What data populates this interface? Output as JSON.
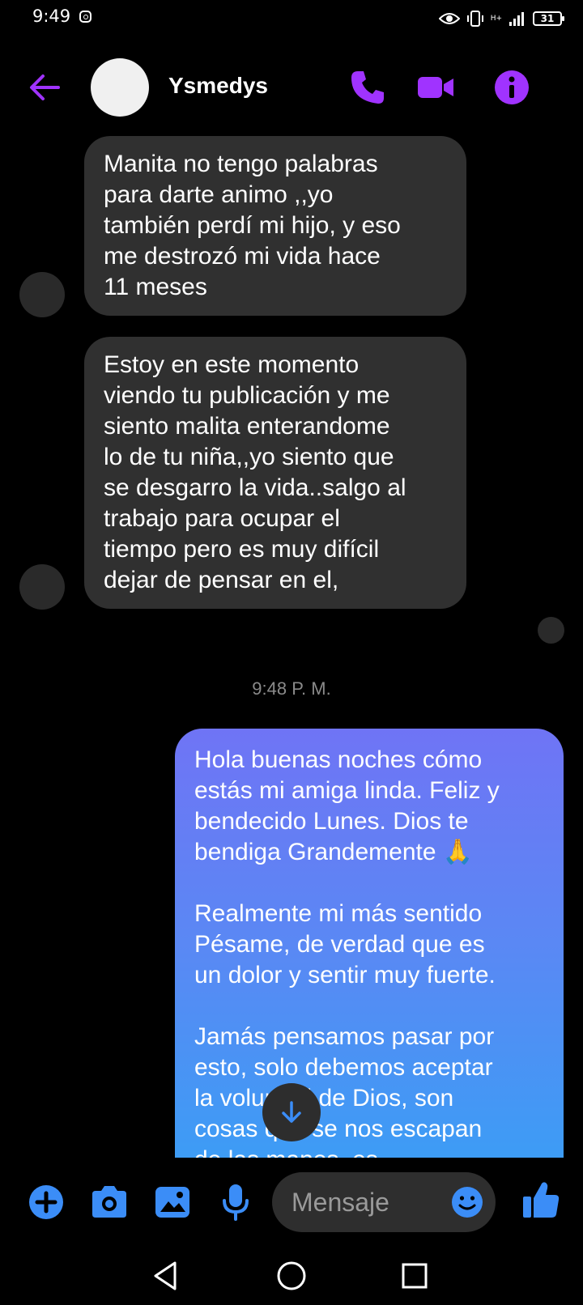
{
  "status_bar": {
    "time": "9:49",
    "battery": "31",
    "network": "H+"
  },
  "header": {
    "contact_name": "Ysmedys"
  },
  "messages": {
    "incoming": [
      "Manita no tengo palabras\npara darte animo ,,yo\ntambién perdí mi hijo, y eso\nme destrozó mi vida hace\n11 meses",
      "Estoy en este momento\nviendo tu publicación y me\nsiento malita enterandome\nlo de tu niña,,yo siento que\nse desgarro la vida..salgo al\ntrabajo para ocupar el\ntiempo pero es muy difícil\ndejar de pensar en el,"
    ],
    "timestamp": "9:48 P. M.",
    "outgoing": "Hola buenas noches cómo\nestás mi amiga linda. Feliz y\nbendecido Lunes. Dios te\nbendiga Grandemente 🙏\n\nRealmente mi más sentido\nPésame, de verdad que es\nun dolor y sentir muy fuerte.\n\nJamás pensamos pasar por\nesto, solo debemos aceptar\nla voluntad de Dios, son\ncosas que se nos escapan\nde las manos, es"
  },
  "composer": {
    "placeholder": "Mensaje"
  },
  "colors": {
    "accent": "#a033ff",
    "blue": "#3b8df7",
    "incoming_bubble": "#303030"
  },
  "icons": [
    "arrow-left-icon",
    "phone-icon",
    "video-icon",
    "info-icon",
    "plus-icon",
    "camera-icon",
    "image-icon",
    "mic-icon",
    "emoji-icon",
    "thumbs-up-icon",
    "arrow-down-icon"
  ]
}
